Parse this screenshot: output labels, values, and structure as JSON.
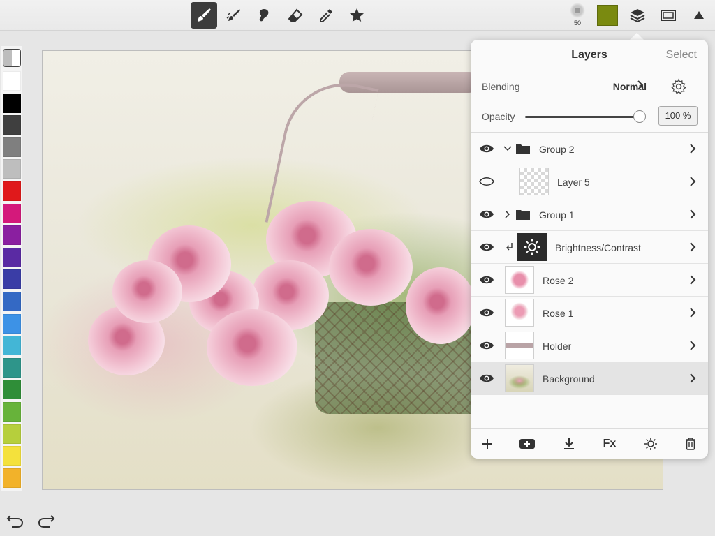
{
  "toolbar": {
    "tools": [
      {
        "id": "paint-brush",
        "icon": "paintbrush-icon",
        "active": true
      },
      {
        "id": "smudge",
        "icon": "smudge-brush-icon",
        "active": false
      },
      {
        "id": "lasso",
        "icon": "lasso-icon",
        "active": false
      },
      {
        "id": "eraser",
        "icon": "eraser-icon",
        "active": false
      },
      {
        "id": "eyedropper",
        "icon": "eyedropper-icon",
        "active": false
      },
      {
        "id": "favorites",
        "icon": "star-icon",
        "active": false
      }
    ],
    "brush_size": "50",
    "current_color": "#7a8a10"
  },
  "palette": {
    "colors": [
      "#ffffff",
      "#000000",
      "#3f3f3f",
      "#7f7f7f",
      "#bebebe",
      "#e0191b",
      "#d4197b",
      "#8a1fa0",
      "#5a2aa3",
      "#3a3da6",
      "#3469c4",
      "#3d92e6",
      "#43b6d6",
      "#2e958a",
      "#2f8e38",
      "#67b33a",
      "#b6cf3c",
      "#f4e13c",
      "#f2b22a"
    ]
  },
  "layers_panel": {
    "title": "Layers",
    "select_label": "Select",
    "blending_label": "Blending",
    "blending_value": "Normal",
    "opacity_label": "Opacity",
    "opacity_value": "100 %",
    "opacity_level": 1.0,
    "layers": [
      {
        "name": "Group 2",
        "type": "group",
        "expanded": true,
        "visible": true,
        "indent": 0
      },
      {
        "name": "Layer 5",
        "type": "layer",
        "thumb": "checker",
        "visible": false,
        "indent": 1
      },
      {
        "name": "Group 1",
        "type": "group",
        "expanded": false,
        "visible": true,
        "indent": 0
      },
      {
        "name": "Brightness/Contrast",
        "type": "adjustment",
        "thumb": "adjust",
        "visible": true,
        "indent": 0
      },
      {
        "name": "Rose 2",
        "type": "layer",
        "thumb": "rose2",
        "visible": true,
        "indent": 0
      },
      {
        "name": "Rose 1",
        "type": "layer",
        "thumb": "rose1",
        "visible": true,
        "indent": 0
      },
      {
        "name": "Holder",
        "type": "layer",
        "thumb": "holder",
        "visible": true,
        "indent": 0
      },
      {
        "name": "Background",
        "type": "layer",
        "thumb": "bg",
        "visible": true,
        "indent": 0,
        "selected": true
      }
    ],
    "footer_fx_label": "Fx"
  }
}
